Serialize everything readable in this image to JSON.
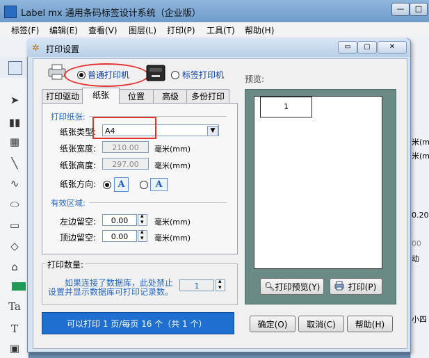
{
  "main_window": {
    "title": "Label mx 通用条码标签设计系统（企业版）",
    "buttons": {
      "minimize": "—",
      "maximize": "□"
    }
  },
  "menu": [
    "标签(F)",
    "编辑(E)",
    "查看(V)",
    "图层(L)",
    "打印(P)",
    "工具(T)",
    "帮助(H)"
  ],
  "right_strip": [
    "米(m",
    "米(m",
    "0.20",
    "00",
    "动",
    "小四"
  ],
  "dialog": {
    "title": "打印设置",
    "title_buttons": {
      "minimize": "▭",
      "restore": "▢",
      "close": "✕"
    },
    "printer_options": [
      {
        "label": "普通打印机",
        "selected": true
      },
      {
        "label": "标签打印机",
        "selected": false
      }
    ],
    "tabs": [
      "打印驱动",
      "纸张",
      "位置",
      "高级",
      "多份打印"
    ],
    "active_tab": "纸张",
    "paper": {
      "section": "打印纸张:",
      "type_label": "纸张类型:",
      "type_value": "A4",
      "width_label": "纸张宽度:",
      "width_value": "210.00",
      "height_label": "纸张高度:",
      "height_value": "297.00",
      "unit": "毫米(mm)",
      "orientation_label": "纸张方向:",
      "orientation_glyph": "A",
      "orientation_selected": "portrait"
    },
    "area": {
      "section": "有效区域:",
      "left_label": "左边留空:",
      "left_value": "0.00",
      "top_label": "顶边留空:",
      "top_value": "0.00",
      "unit": "毫米(mm)"
    },
    "print_count": {
      "legend": "打印数量:",
      "note_line1": "如果连接了数据库，此处禁止",
      "note_line2": "设置并显示数据库可打印记录数。",
      "value": "1"
    },
    "status": "可以打印 1 页/每页 16 个（共 1 个）",
    "preview": {
      "label": "预览:",
      "label_number": "1",
      "preview_button": "打印预览(Y)",
      "print_button": "打印(P)"
    },
    "buttons": {
      "ok": "确定(O)",
      "cancel": "取消(C)",
      "help": "帮助(H)"
    }
  },
  "colors": {
    "highlight": "#e53030",
    "status_bg": "#1f6fd1",
    "status_text": "#ffffff",
    "preview_bg": "#6a8a86",
    "section_text": "#2566c5"
  }
}
